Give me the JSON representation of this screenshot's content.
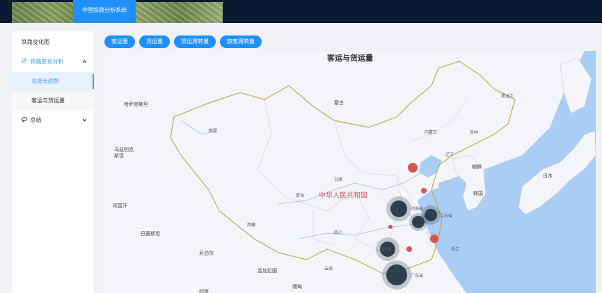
{
  "header": {
    "system_title": "中国铁路分析系统"
  },
  "sidebar": {
    "item_overview": "铁路变化图",
    "group_analysis": {
      "label": "铁路变化分析",
      "icon": "chart-icon"
    },
    "sub_total_trend": "总增长趋势",
    "sub_passenger_freight": "客运与货运量",
    "group_summary": {
      "label": "总结",
      "icon": "chat-icon"
    }
  },
  "toolbar": {
    "pills": [
      "客运量",
      "货运量",
      "货运周转量",
      "旅客周转量"
    ]
  },
  "map": {
    "title": "客运与货运量",
    "labels": [
      {
        "text": "哈萨克斯坦",
        "cls": "big"
      },
      {
        "text": "蒙古",
        "cls": "big"
      },
      {
        "text": "乌兹别克\n斯坦",
        "cls": "big"
      },
      {
        "text": "阿富汗",
        "cls": "big"
      },
      {
        "text": "巴基斯坦",
        "cls": "big"
      },
      {
        "text": "尼泊尔",
        "cls": "big"
      },
      {
        "text": "孟加拉国",
        "cls": "big"
      },
      {
        "text": "缅甸",
        "cls": "big"
      },
      {
        "text": "印度",
        "cls": "big"
      },
      {
        "text": "朝鲜",
        "cls": "big"
      },
      {
        "text": "韩国",
        "cls": "big"
      },
      {
        "text": "日本",
        "cls": "big"
      },
      {
        "text": "中华人民共和国",
        "cls": "cn"
      },
      {
        "text": "内蒙古",
        "cls": ""
      },
      {
        "text": "新疆",
        "cls": ""
      },
      {
        "text": "西藏",
        "cls": ""
      },
      {
        "text": "青海",
        "cls": ""
      },
      {
        "text": "甘肃",
        "cls": ""
      },
      {
        "text": "四川",
        "cls": ""
      },
      {
        "text": "云南",
        "cls": ""
      },
      {
        "text": "黑龙江",
        "cls": ""
      },
      {
        "text": "吉林",
        "cls": ""
      },
      {
        "text": "辽宁",
        "cls": ""
      },
      {
        "text": "河南省",
        "cls": ""
      },
      {
        "text": "江苏省",
        "cls": ""
      },
      {
        "text": "湖南省",
        "cls": ""
      },
      {
        "text": "广东省",
        "cls": ""
      },
      {
        "text": "浙江",
        "cls": ""
      }
    ],
    "markers_large": [
      {
        "name": "henan"
      },
      {
        "name": "jiangsu"
      },
      {
        "name": "anhui"
      },
      {
        "name": "hunan"
      },
      {
        "name": "guangdong"
      }
    ],
    "markers_small": [
      {
        "name": "hebei"
      },
      {
        "name": "shandong"
      },
      {
        "name": "hubei"
      },
      {
        "name": "zhejiang"
      },
      {
        "name": "jiangxi"
      }
    ],
    "colors": {
      "marker_large": "#2f3e4e",
      "marker_small": "#d9534f",
      "sea": "#a9cdf5",
      "land": "#f3f5fa"
    }
  }
}
